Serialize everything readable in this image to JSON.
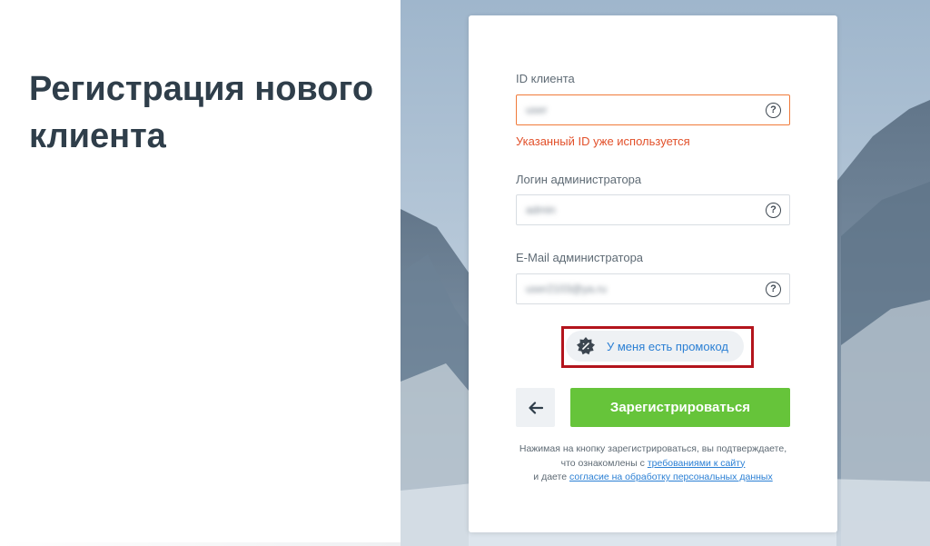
{
  "page": {
    "title": "Регистрация нового клиента"
  },
  "form": {
    "client_id": {
      "label": "ID клиента",
      "value": "user",
      "error": "Указанный ID уже используется"
    },
    "admin_login": {
      "label": "Логин администратора",
      "value": "admin"
    },
    "admin_email": {
      "label": "E-Mail администратора",
      "value": "user2103@ya.ru"
    },
    "help_glyph": "?",
    "promo_label": "У меня есть промокод",
    "back_glyph": "←",
    "register_label": "Зарегистрироваться",
    "disclaimer": {
      "line1": "Нажимая на кнопку зарегистрироваться, вы подтверждаете,",
      "line2_prefix": "что ознакомлены с ",
      "line2_link": "требованиями к сайту",
      "line3_prefix": "и даете ",
      "line3_link": "согласие на обработку персональных данных"
    }
  },
  "colors": {
    "error": "#e2502a",
    "accent_green": "#66c43a",
    "link_blue": "#2a7fd4",
    "highlight_red": "#b3141c"
  },
  "icons": {
    "help": "question-circle-icon",
    "promo": "promo-badge-icon",
    "back": "arrow-left-icon"
  }
}
